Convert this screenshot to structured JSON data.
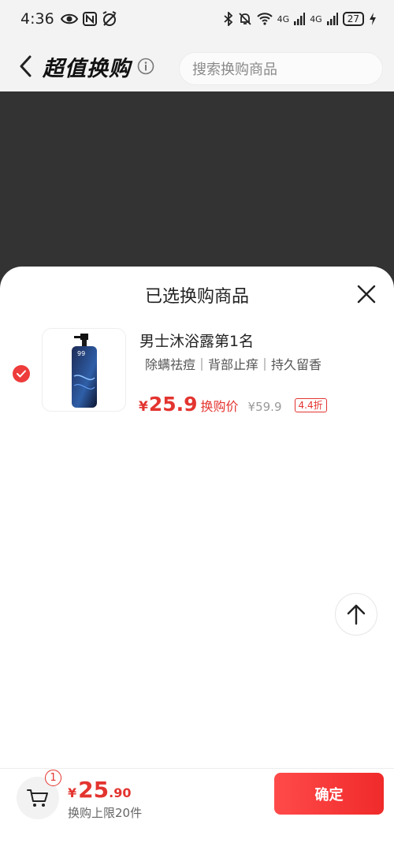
{
  "status_bar": {
    "time": "4:36",
    "signal_1": "4G",
    "signal_2": "4G",
    "battery": "27"
  },
  "header": {
    "title": "超值换购",
    "search_placeholder": "搜索换购商品"
  },
  "sheet": {
    "title": "已选换购商品",
    "item": {
      "name": "男士沐浴露第1名",
      "tags": "除螨祛痘｜背部止痒｜持久留香",
      "currency": "¥",
      "price": "25.9",
      "price_label": "换购价",
      "original_price": "¥59.9",
      "discount": "4.4折",
      "selected": true
    }
  },
  "bottom_bar": {
    "cart_count": "1",
    "total_currency": "¥",
    "total_integer": "25",
    "total_decimal": ".90",
    "limit_text": "换购上限20件",
    "confirm_label": "确定"
  },
  "colors": {
    "accent": "#e3342f",
    "overlay": "#333333"
  }
}
